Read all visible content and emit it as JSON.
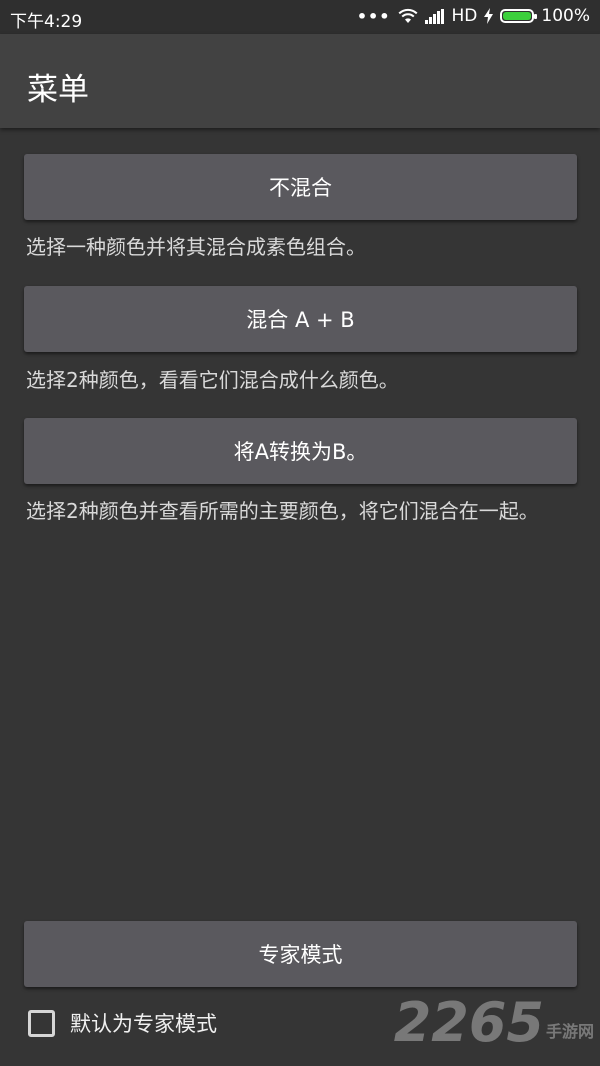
{
  "status_bar": {
    "time": "下午4:29",
    "more": "•••",
    "network": "HD",
    "battery_text": "100%",
    "battery_level": 1.0,
    "battery_color": "#3ccf3c"
  },
  "app_bar": {
    "title": "菜单"
  },
  "menu": [
    {
      "button": "不混合",
      "description": "选择一种颜色并将其混合成素色组合。"
    },
    {
      "button": "混合 A + B",
      "description": "选择2种颜色，看看它们混合成什么颜色。"
    },
    {
      "button": "将A转换为B。",
      "description": "选择2种颜色并查看所需的主要颜色，将它们混合在一起。"
    }
  ],
  "expert_button": "专家模式",
  "default_checkbox": {
    "label": "默认为专家模式",
    "checked": false
  },
  "watermark": {
    "number": "2265",
    "text": "手游网"
  },
  "colors": {
    "background": "#353535",
    "app_bar": "#424242",
    "button": "#5a595e"
  }
}
